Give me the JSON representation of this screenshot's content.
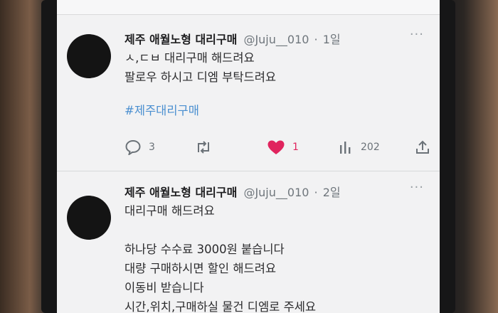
{
  "tweets": [
    {
      "author": "제주 애월노형 대리구매",
      "handle": "@Juju__010",
      "separator": "·",
      "time": "1일",
      "lines": [
        "ㅅ,ㄷㅂ 대리구매 해드려요",
        "팔로우 하시고 디엠 부탁드려요"
      ],
      "hashtag": "#제주대리구매",
      "replies": "3",
      "retweets": "",
      "likes": "1",
      "views": "202",
      "like_color": "#e0245e"
    },
    {
      "author": "제주 애월노형 대리구매",
      "handle": "@Juju__010",
      "separator": "·",
      "time": "2일",
      "lines": [
        "대리구매 해드려요",
        "",
        "하나당 수수료 3000원 붙습니다",
        "대량 구매하시면 할인 해드려요",
        "이동비 받습니다",
        "시간,위치,구매하실 물건 디엠로 주세요"
      ]
    }
  ],
  "icons": {
    "reply": "reply-icon",
    "retweet": "retweet-icon",
    "like": "heart-icon",
    "views": "views-icon",
    "share": "share-icon",
    "more": "more-icon"
  }
}
